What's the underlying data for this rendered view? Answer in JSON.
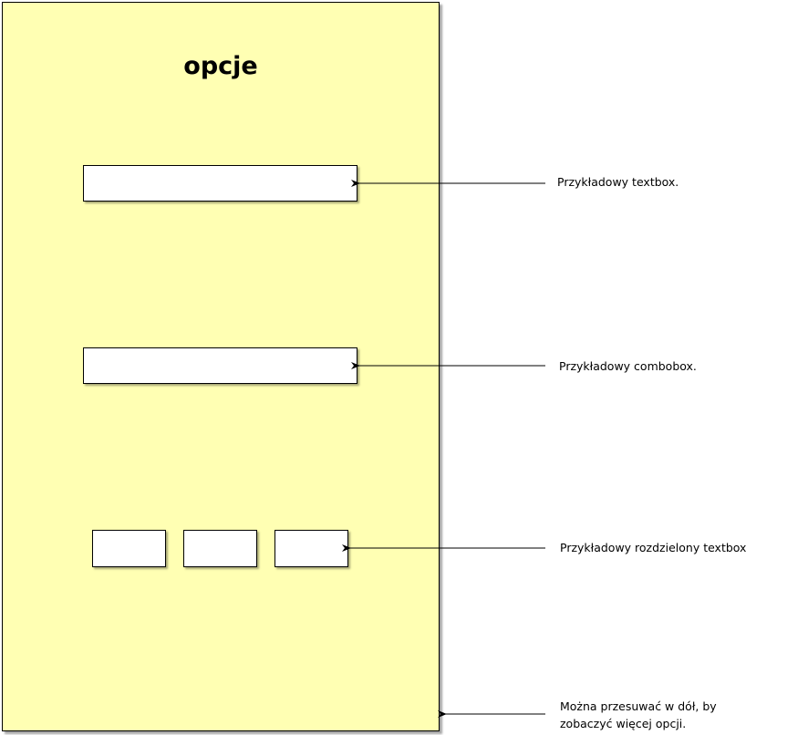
{
  "panel": {
    "title": "opcje",
    "background_color": "#ffffb3"
  },
  "annotations": {
    "textbox": "Przykładowy textbox.",
    "combobox": "Przykładowy combobox.",
    "split_textbox": "Przykładowy rozdzielony textbox",
    "scroll_line1": "Można przesuwać w dół, by",
    "scroll_line2": "zobaczyć więcej opcji."
  }
}
